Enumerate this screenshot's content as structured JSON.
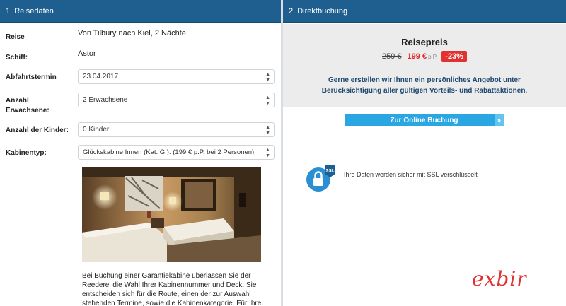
{
  "left_panel": {
    "title": "1. Reisedaten",
    "fields": {
      "reise": {
        "label": "Reise",
        "value": "Von Tilbury nach Kiel, 2 Nächte"
      },
      "schiff": {
        "label": "Schiff:",
        "value": "Astor"
      },
      "abfahrt": {
        "label": "Abfahrtstermin",
        "value": "23.04.2017"
      },
      "erwachsene": {
        "label_line1": "Anzahl",
        "label_line2": "Erwachsene:",
        "value": "2 Erwachsene"
      },
      "kinder": {
        "label": "Anzahl der Kinder:",
        "value": "0 Kinder"
      },
      "kabinentyp": {
        "label": "Kabinentyp:",
        "value": "Glückskabine Innen (Kat. GI): (199 € p.P. bei 2 Personen)"
      }
    },
    "description": "Bei Buchung einer Garantiekabine überlassen Sie der Reederei die Wahl Ihrer Kabinennummer und Deck. Sie entscheiden sich für die Route, einen der zur Auswahl stehenden Termine, sowie die Kabinenkategorie. Für Ihre"
  },
  "right_panel": {
    "title": "2. Direktbuchung",
    "price_title": "Reisepreis",
    "old_price": "259 €",
    "new_price": "199 €",
    "per_person": "p.P.",
    "discount": "-23%",
    "offer_line1": "Gerne erstellen wir Ihnen ein persönliches Angebot unter",
    "offer_line2": "Berücksichtigung aller gültigen Vorteils- und Rabattaktionen.",
    "booking_button": "Zur Online Buchung",
    "booking_chevron": "»",
    "ssl_badge": "SSL",
    "ssl_text": "Ihre Daten werden sicher mit SSL verschlüsselt"
  },
  "brand": "exbir",
  "colors": {
    "header": "#1f5f8f",
    "accent": "#2aa7e2",
    "discount": "#e23131",
    "offer_text": "#1f4970"
  }
}
